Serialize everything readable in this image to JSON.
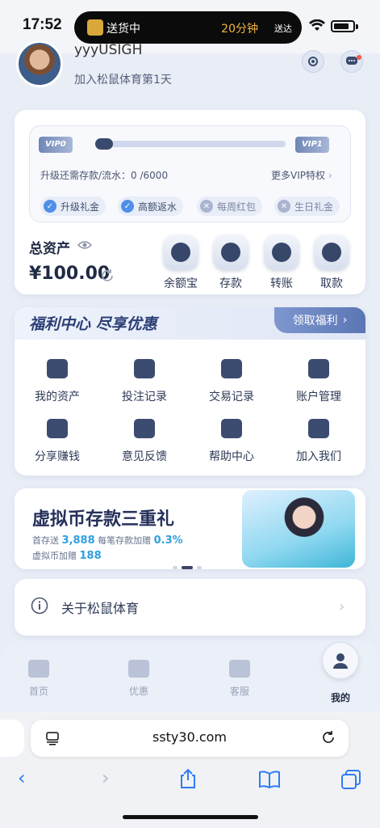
{
  "status": {
    "time": "17:52",
    "island_left": "送货中",
    "island_right": "20分钟",
    "island_right_suffix": "送达"
  },
  "profile": {
    "username": "yyyUSIGH",
    "join_text": "加入松鼠体育第1天"
  },
  "vip": {
    "current_level": "VIP0",
    "next_level": "VIP1",
    "progress": 0,
    "need_text": "升级还需存款/流水：0 /6000",
    "more_text": "更多VIP特权",
    "perks": [
      {
        "label": "升级礼金",
        "enabled": true
      },
      {
        "label": "高额返水",
        "enabled": true
      },
      {
        "label": "每周红包",
        "enabled": false
      },
      {
        "label": "生日礼金",
        "enabled": false
      }
    ]
  },
  "assets": {
    "label": "总资产",
    "value": "¥100.00",
    "actions": [
      {
        "label": "余额宝",
        "icon": "coins-icon"
      },
      {
        "label": "存款",
        "icon": "wallet-icon"
      },
      {
        "label": "转账",
        "icon": "transfer-icon"
      },
      {
        "label": "取款",
        "icon": "card-icon"
      }
    ]
  },
  "welfare": {
    "title": "福利中心 尽享优惠",
    "button": "领取福利",
    "items": [
      {
        "label": "我的资产",
        "icon": "wallet-icon"
      },
      {
        "label": "投注记录",
        "icon": "receipt-icon"
      },
      {
        "label": "交易记录",
        "icon": "exchange-icon"
      },
      {
        "label": "账户管理",
        "icon": "folder-icon"
      },
      {
        "label": "分享赚钱",
        "icon": "heart-hands-icon"
      },
      {
        "label": "意见反馈",
        "icon": "feedback-icon"
      },
      {
        "label": "帮助中心",
        "icon": "help-book-icon"
      },
      {
        "label": "加入我们",
        "icon": "people-icon"
      }
    ]
  },
  "promo": {
    "title": "虚拟币存款三重礼",
    "line1_a": "首存送",
    "line1_b": "3,888",
    "line1_c": "每笔存款加赠",
    "line1_d": "0.3%",
    "line2_a": "虚拟币加赠",
    "line2_b": "188",
    "active_dot": 1
  },
  "about": {
    "label": "关于松鼠体育"
  },
  "tabs": [
    {
      "label": "首页",
      "icon": "home-icon"
    },
    {
      "label": "优惠",
      "icon": "ticket-icon"
    },
    {
      "label": "客服",
      "icon": "headset-icon"
    },
    {
      "label": "我的",
      "icon": "user-icon",
      "active": true
    }
  ],
  "browser": {
    "url": "ssty30.com"
  },
  "colors": {
    "accent": "#2f7cf6",
    "brand_dark": "#2c3f75",
    "highlight": "#2f9fe0"
  }
}
